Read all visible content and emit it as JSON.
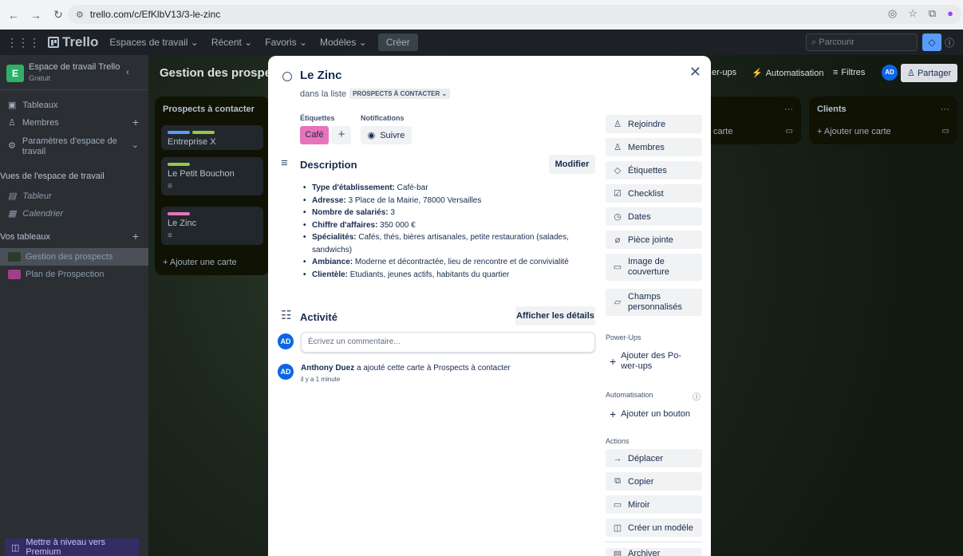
{
  "browser": {
    "url": "trello.com/c/EfKlbV13/3-le-zinc"
  },
  "header": {
    "logo": "Trello",
    "menu": [
      "Espaces de travail",
      "Récent",
      "Favoris",
      "Modèles"
    ],
    "create": "Créer",
    "search_placeholder": "Parcourir"
  },
  "sidebar": {
    "workspace_initial": "E",
    "workspace_name": "Espace de travail Trello",
    "workspace_plan": "Gratuit",
    "boards_item": "Tableaux",
    "members_item": "Membres",
    "settings_item_line1": "Paramètres d'espace de",
    "settings_item_line2": "travail",
    "views_section": "Vues de l'espace de travail",
    "view_table": "Tableur",
    "view_calendar": "Calendrier",
    "your_boards": "Vos tableaux",
    "boards": [
      {
        "name": "Gestion des prospects",
        "color": "#2b3a2b"
      },
      {
        "name": "Plan de Prospection",
        "color": "#a33e88"
      }
    ],
    "premium": "Mettre à niveau vers Premium"
  },
  "board": {
    "title": "Gestion des prospects",
    "powerups": "er-ups",
    "automation": "Automatisation",
    "filters": "Filtres",
    "avatar": "AD",
    "share": "Partager",
    "lists": [
      {
        "title": "Prospects à contacter",
        "cards": [
          {
            "title": "Entreprise X"
          },
          {
            "title": "Le Petit Bouchon"
          },
          {
            "title": "Le Zinc"
          }
        ],
        "add_card": "Ajouter une carte"
      },
      {
        "title": "",
        "add_card": "carte"
      },
      {
        "title": "Clients",
        "add_card": "Ajouter une carte"
      }
    ]
  },
  "card": {
    "title": "Le Zinc",
    "in_list_prefix": "dans la liste",
    "list_name": "PROSPECTS À CONTACTER",
    "labels_heading": "Étiquettes",
    "notifications_heading": "Notifications",
    "label": "Café",
    "label_color": "#e774bb",
    "follow": "Suivre",
    "description_heading": "Description",
    "edit_button": "Modifier",
    "description": [
      {
        "key": "Type d'établissement:",
        "value": " Café-bar"
      },
      {
        "key": "Adresse:",
        "value": " 3 Place de la Mairie, 78000 Versailles"
      },
      {
        "key": "Nombre de salariés:",
        "value": " 3"
      },
      {
        "key": "Chiffre d'affaires:",
        "value": " 350 000 €"
      },
      {
        "key": "Spécialités:",
        "value": " Cafés, thés, bières artisanales, petite restauration (salades, sandwichs)"
      },
      {
        "key": "Ambiance:",
        "value": " Moderne et décontractée, lieu de rencontre et de convivialité"
      },
      {
        "key": "Clientèle:",
        "value": " Etudiants, jeunes actifs, habitants du quartier"
      }
    ],
    "activity_heading": "Activité",
    "details_button": "Afficher les détails",
    "avatar": "AD",
    "comment_placeholder": "Écrivez un commentaire...",
    "activity_user": "Anthony Duez",
    "activity_text": " a ajouté cette carte à Prospects à contacter",
    "activity_time": "il y a 1 minute",
    "actions": {
      "join": "Rejoindre",
      "members": "Membres",
      "labels": "Étiquettes",
      "checklist": "Checklist",
      "dates": "Dates",
      "attachment": "Pièce jointe",
      "cover_line1": "Image de",
      "cover_line2": "couverture",
      "custom_line1": "Champs",
      "custom_line2": "personnalisés",
      "powerups_heading": "Power-Ups",
      "add_powerups_line1": "Ajouter des Po-",
      "add_powerups_line2": "wer-ups",
      "automation_heading": "Automatisation",
      "add_button": "Ajouter un bouton",
      "actions_heading": "Actions",
      "move": "Déplacer",
      "copy": "Copier",
      "mirror": "Miroir",
      "template": "Créer un modèle",
      "archive": "Archiver"
    }
  },
  "colors": {
    "accent": "#0c66e4",
    "header_bg": "#1d2125"
  }
}
